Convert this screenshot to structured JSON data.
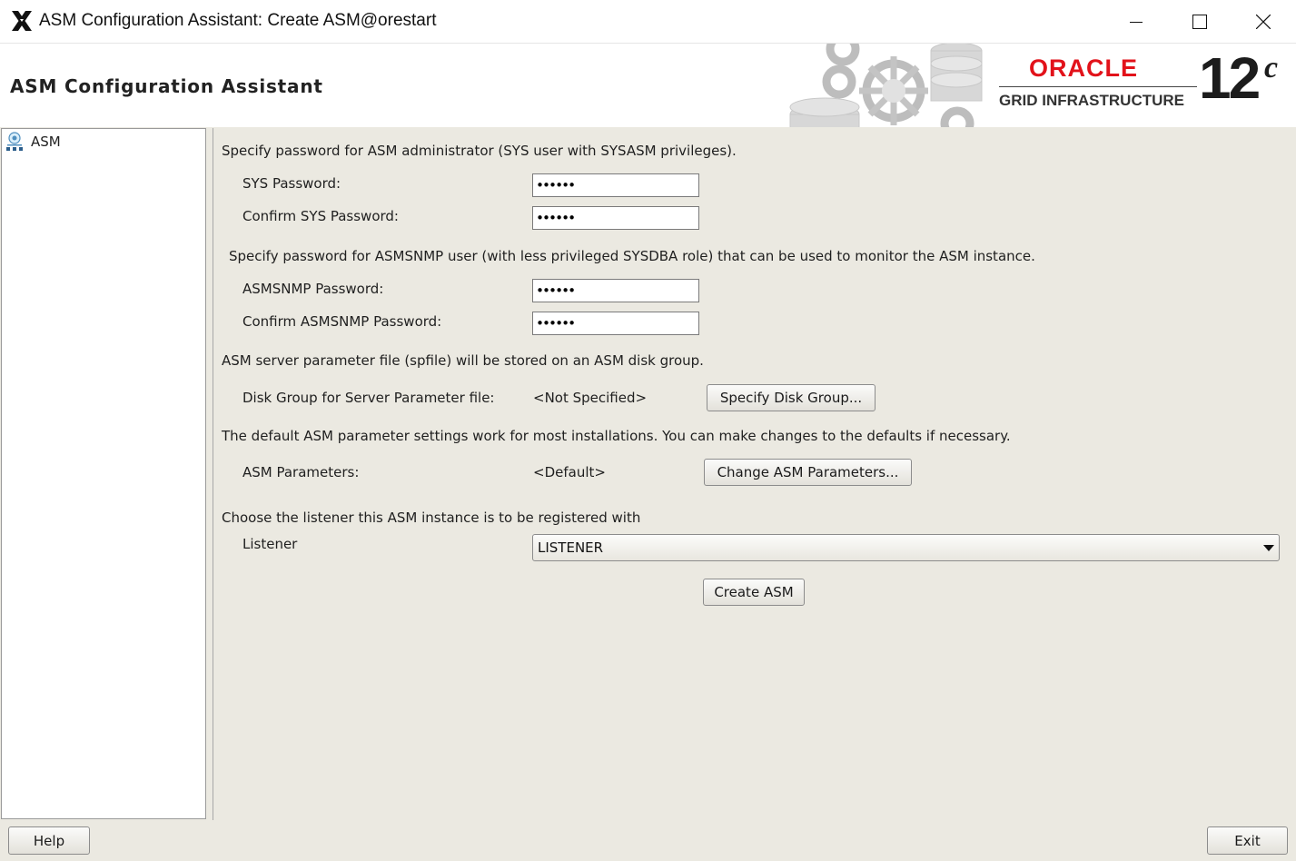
{
  "window": {
    "title": "ASM Configuration Assistant: Create ASM@orestart"
  },
  "banner": {
    "title": "ASM Configuration Assistant",
    "brand": "ORACLE",
    "product": "GRID INFRASTRUCTURE",
    "version": "12",
    "version_suffix": "c",
    "brand_color": "#e2121a"
  },
  "nav": {
    "items": [
      {
        "label": "ASM",
        "icon": "asm-instance-icon",
        "selected": true
      }
    ]
  },
  "sys_section": {
    "description": "Specify password for ASM administrator (SYS user with SYSASM privileges).",
    "sys_password_label": "SYS Password:",
    "sys_password_value": "••••••",
    "confirm_sys_password_label": "Confirm SYS Password:",
    "confirm_sys_password_value": "••••••"
  },
  "asmsnmp_section": {
    "description": "Specify password for ASMSNMP user (with less privileged SYSDBA role) that can be used to monitor the ASM instance.",
    "password_label": "ASMSNMP Password:",
    "password_value": "••••••",
    "confirm_label": "Confirm ASMSNMP Password:",
    "confirm_value": "••••••"
  },
  "spfile_section": {
    "description": "ASM server parameter file (spfile) will be stored on an ASM disk group.",
    "disk_group_label": "Disk Group for Server Parameter file:",
    "disk_group_value": "<Not Specified>",
    "specify_button": "Specify Disk Group..."
  },
  "params_section": {
    "description": "The default ASM parameter settings work for most installations. You can make changes to the defaults if necessary.",
    "params_label": "ASM Parameters:",
    "params_value": "<Default>",
    "change_button": "Change ASM Parameters..."
  },
  "listener_section": {
    "description": "Choose the listener this ASM instance is to be registered with",
    "listener_label": "Listener",
    "listener_selected": "LISTENER"
  },
  "actions": {
    "create_button": "Create ASM",
    "help_button": "Help",
    "exit_button": "Exit"
  }
}
